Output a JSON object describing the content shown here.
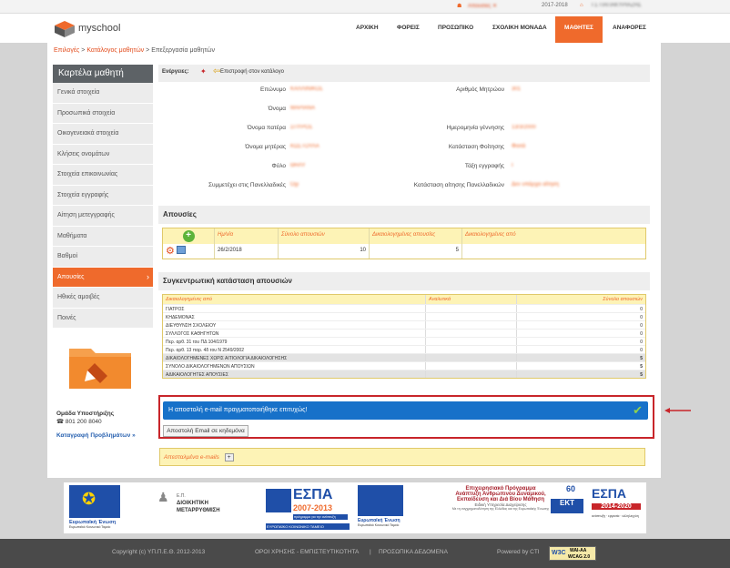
{
  "topbar": {
    "absences_label": "Απουσίες ✕",
    "year": "2017-2018",
    "school_label": "ΓΣ ΠΑΠΑΚΥΡΙΑΖΗΣ"
  },
  "logo": {
    "text": "myschool"
  },
  "nav": {
    "items": [
      "ΑΡΧΙΚΗ",
      "ΦΟΡΕΙΣ",
      "ΠΡΟΣΩΠΙΚΟ",
      "ΣΧΟΛΙΚΗ ΜΟΝΑΔΑ",
      "ΜΑΘΗΤΕΣ",
      "ΑΝΑΦΟΡΕΣ"
    ],
    "active": "ΜΑΘΗΤΕΣ"
  },
  "breadcrumb": {
    "part1": "Επιλογές",
    "part2": "Κατάλογος μαθητών",
    "part3": "Επεξεργασία μαθητών",
    "sep": ">"
  },
  "sidebar": {
    "title": "Καρτέλα μαθητή",
    "items": [
      "Γενικά στοιχεία",
      "Προσωπικά στοιχεία",
      "Οικογενειακά στοιχεία",
      "Κλήσεις ονομάτων",
      "Στοιχεία επικοινωνίας",
      "Στοιχεία εγγραφής",
      "Αίτηση μετεγγραφής",
      "Μαθήματα",
      "Βαθμοί",
      "Απουσίες",
      "Ηθικές αμοιβές",
      "Ποινές"
    ],
    "active_index": 9,
    "support_title": "Ομάδα Υποστήριξης",
    "support_phone": "☎ 801 200 8040",
    "support_link": "Καταγραφή Προβλημάτων »"
  },
  "actions": {
    "label": "Ενέργειες:",
    "back_label": "Επιστροφή στον κατάλογο"
  },
  "student": {
    "left": [
      {
        "label": "Επώνυμο",
        "value": "ΚΑΛΛΙΝΙΚΟΣ"
      },
      {
        "label": "Όνομα",
        "value": "ΜΑΡΙΑΝΑ"
      },
      {
        "label": "Όνομα πατέρα",
        "value": "ΣΠΥΡΟΣ"
      },
      {
        "label": "Όνομα μητέρας",
        "value": "ΚΩΣΤΟΥΛΑ"
      },
      {
        "label": "Φύλο",
        "value": "ΘΗΛΥ"
      },
      {
        "label": "Συμμετέχει στις Πανελλαδικές",
        "value": "Όχι"
      }
    ],
    "right": [
      {
        "label": "Αριθμός Μητρώου",
        "value": "301"
      },
      {
        "label": "Ημερομηνία γέννησης",
        "value": "13/3/2000"
      },
      {
        "label": "Κατάσταση Φοίτησης",
        "value": "Φοιτά"
      },
      {
        "label": "Τάξη εγγραφής",
        "value": "Γ"
      },
      {
        "label": "Κατάσταση αίτησης Πανελλαδικών",
        "value": "Δεν υπάρχει αίτηση"
      }
    ]
  },
  "absences": {
    "title": "Απουσίες",
    "headers": [
      "Ημ/νία",
      "Σύνολο απουσιών",
      "Δικαιολογημένες απουσίες",
      "Δικαιολογημένες από"
    ],
    "rows": [
      {
        "date": "26/2/2018",
        "total": "10",
        "justified": "5",
        "by": ""
      }
    ]
  },
  "summary": {
    "title": "Συγκεντρωτική κατάσταση απουσιών",
    "headers": [
      "Δικαιολογημένες από",
      "Αναλυτικά",
      "Σύνολο απουσιών"
    ],
    "rows": [
      {
        "label": "ΓΙΑΤΡΟΣ",
        "value": "0",
        "style": ""
      },
      {
        "label": "ΚΗΔΕΜΟΝΑΣ",
        "value": "0",
        "style": ""
      },
      {
        "label": "ΔΙΕΥΘΥΝΣΗ ΣΧΟΛΕΙΟΥ",
        "value": "0",
        "style": ""
      },
      {
        "label": "ΣΥΛΛΟΓΟΣ ΚΑΘΗΓΗΤΩΝ",
        "value": "0",
        "style": ""
      },
      {
        "label": "Περ. αρθ. 31 του ΠΔ 104/1979",
        "value": "0",
        "style": ""
      },
      {
        "label": "Περ. αρθ. 13 παρ. 4δ του Ν 2549/2002",
        "value": "0",
        "style": ""
      },
      {
        "label": "ΔΙΚΑΙΟΛΟΓΗΜΕΝΕΣ ΧΩΡΙΣ ΑΙΤΙΟΛΟΓΙΑ ΔΙΚΑΙΟΛΟΓΗΣΗΣ",
        "value": "5",
        "style": "grey"
      },
      {
        "label": "ΣΥΝΟΛΟ ΔΙΚΑΙΟΛΟΓΗΜΕΝΩΝ ΑΠΟΥΣΙΩΝ",
        "value": "5",
        "style": ""
      },
      {
        "label": "ΑΔΙΚΑΙΟΛΟΓΗΤΕΣ ΑΠΟΥΣΙΕΣ",
        "value": "5",
        "style": "grey"
      }
    ]
  },
  "message": {
    "success": "Η αποστολή e-mail πραγματοποιήθηκε επιτυχώς!",
    "email_button": "Αποστολή Email σε κηδεμόνα"
  },
  "sent_mails": {
    "label": "Απεσταλμένα e-mails",
    "toggle": "+"
  },
  "logos": {
    "eu_label": "Ευρωπαϊκή Ένωση",
    "eu_sub": "Ευρωπαϊκό Κοινωνικό Ταμείο",
    "admin_reform": "ΔΙΟΙΚΗΤΙΚΗ ΜΕΤΑΡΡΥΘΜΙΣΗ",
    "admin_ep": "Ε.Π.",
    "espa1": "ΕΣΠΑ",
    "espa1_years": "2007-2013",
    "espa1_sub": "πρόγραμμα για την ανάπτυξη",
    "espa1_fund": "ΕΥΡΩΠΑΪΚΟ ΚΟΙΝΩΝΙΚΟ ΤΑΜΕΙΟ",
    "program_title": "Επιχειρησιακό Πρόγραμμα",
    "program_line2": "Ανάπτυξη Ανθρώπινου Δυναμικού,",
    "program_line3": "Εκπαίδευση και Διά Βίου Μάθηση",
    "program_line4": "Ειδική Υπηρεσία Διαχείρισης",
    "program_line5": "Με τη συγχρηματοδότηση της Ελλάδας και της Ευρωπαϊκής Ένωσης",
    "espa2": "ΕΣΠΑ",
    "espa2_years": "2014-2020",
    "espa2_sub": "ανάπτυξη · εργασία · αλληλεγγύη",
    "ekt": "ΕΚΤ",
    "years60": "60"
  },
  "footer": {
    "copyright": "Copyright (c) ΥΠ.Π.Ε.Θ. 2012-2013",
    "terms": "ΟΡΟΙ ΧΡΗΣΗΣ - ΕΜΠΙΣΤΕΥΤΙΚΟΤΗΤΑ",
    "sep": "|",
    "privacy": "ΠΡΟΣΩΠΙΚΑ ΔΕΔΟΜΕΝΑ",
    "powered": "Powered by CTI",
    "w3c_label": "W3C",
    "wai": "WAI-AA",
    "wcag": "WCAG 2.0"
  },
  "colors": {
    "accent": "#ef6a2c",
    "success": "#1771c9",
    "highlight": "#c8252a"
  }
}
